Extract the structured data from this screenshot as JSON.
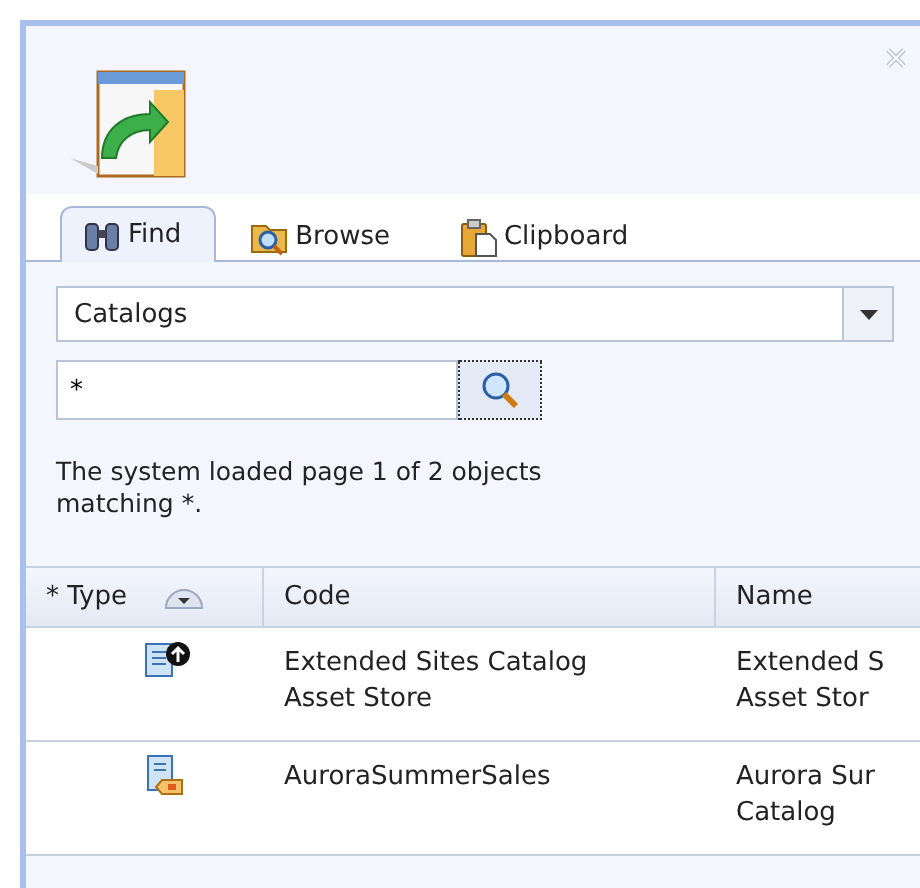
{
  "tabs": [
    {
      "label": "Find",
      "kind": "find",
      "selected": true
    },
    {
      "label": "Browse",
      "kind": "browse",
      "selected": false
    },
    {
      "label": "Clipboard",
      "kind": "clipboard",
      "selected": false
    }
  ],
  "object_type": {
    "value": "Catalogs"
  },
  "search": {
    "value": "*"
  },
  "message": "The system loaded page 1 of 2 objects matching *.",
  "table": {
    "columns": [
      "* Type",
      "Code",
      "Name"
    ],
    "rows": [
      {
        "kind": "extended",
        "code": "Extended Sites Catalog\nAsset Store",
        "name": "Extended S\nAsset Stor"
      },
      {
        "kind": "sales",
        "code": "AuroraSummerSales",
        "name": "Aurora Sur\nCatalog"
      }
    ]
  }
}
